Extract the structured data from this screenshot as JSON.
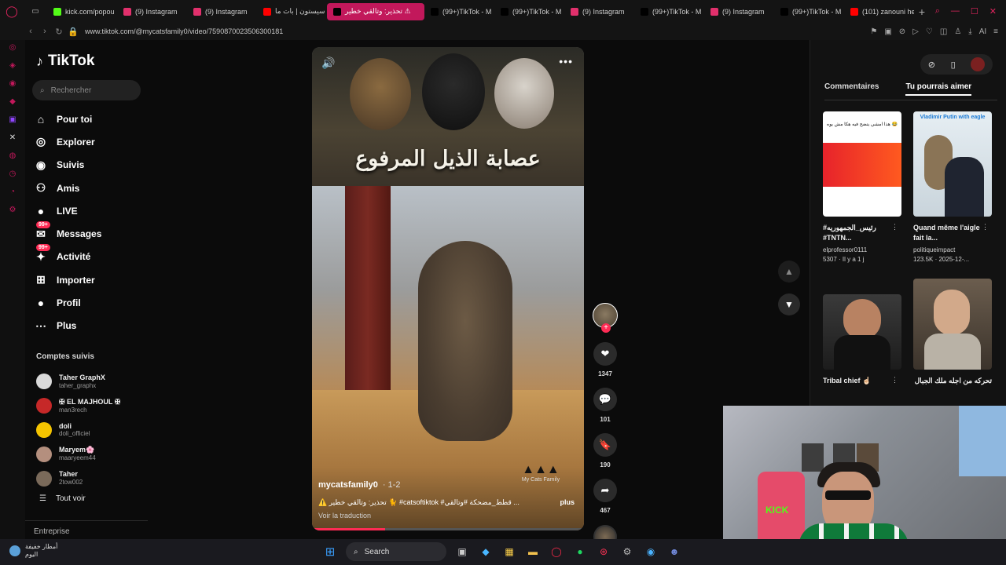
{
  "browser": {
    "tabs": [
      {
        "label": "kick.com/popou",
        "color": "#53fc18"
      },
      {
        "label": "(9) Instagram",
        "color": "#e1306c"
      },
      {
        "label": "(9) Instagram",
        "color": "#e1306c"
      },
      {
        "label": "سيستون | بات ما",
        "color": "#ff0000"
      },
      {
        "label": "تحذير: وتالقي خطير ⚠",
        "color": "#000000",
        "active": true
      },
      {
        "label": "(99+)TikTok - M",
        "color": "#000000"
      },
      {
        "label": "(99+)TikTok - M",
        "color": "#000000"
      },
      {
        "label": "(9) Instagram",
        "color": "#e1306c"
      },
      {
        "label": "(99+)TikTok - M",
        "color": "#000000"
      },
      {
        "label": "(9) Instagram",
        "color": "#e1306c"
      },
      {
        "label": "(99+)TikTok - M",
        "color": "#000000"
      },
      {
        "label": "(101) zanouni he",
        "color": "#ff0000"
      }
    ],
    "url": "www.tiktok.com/@mycatsfamily0/video/7590870023506300181",
    "ai_label": "AI"
  },
  "sidebar": {
    "logo": "TikTok",
    "search_placeholder": "Rechercher",
    "menu": [
      {
        "label": "Pour toi",
        "icon": "home-icon"
      },
      {
        "label": "Explorer",
        "icon": "compass-icon"
      },
      {
        "label": "Suivis",
        "icon": "following-icon"
      },
      {
        "label": "Amis",
        "icon": "friends-icon"
      },
      {
        "label": "LIVE",
        "icon": "live-icon"
      },
      {
        "label": "Messages",
        "icon": "messages-icon",
        "badge": "99+"
      },
      {
        "label": "Activité",
        "icon": "activity-icon",
        "badge": "99+"
      },
      {
        "label": "Importer",
        "icon": "upload-icon"
      },
      {
        "label": "Profil",
        "icon": "profile-icon"
      },
      {
        "label": "Plus",
        "icon": "more-icon"
      }
    ],
    "accounts_title": "Comptes suivis",
    "accounts": [
      {
        "name": "Taher GraphX",
        "handle": "taher_graphx"
      },
      {
        "name": "✠ EL MAJHOUL ✠",
        "handle": "man3rech"
      },
      {
        "name": "doli",
        "handle": "doli_officiel"
      },
      {
        "name": "Maryem🌸",
        "handle": "maaryeem44"
      },
      {
        "name": "Taher",
        "handle": "2tow002"
      }
    ],
    "see_all": "Tout voir",
    "footer": "Entreprise"
  },
  "video": {
    "title_overlay": "عصابة الذيل المرفوع",
    "author": "mycatsfamily0",
    "date": "· 1-2",
    "caption": "⚠️ تحذير: وتالقي خطير 🐈 #catsoftiktok #قطط_مضحكة #وتالقي ...",
    "more": "plus",
    "translate": "Voir la traduction",
    "watermark": "My Cats Family",
    "progress": 0.27
  },
  "actions": {
    "likes": "1347",
    "comments": "101",
    "saves": "190",
    "shares": "467"
  },
  "right_panel": {
    "tabs": [
      "Commentaires",
      "Tu pourrais aimer"
    ],
    "active_tab": 1,
    "recs": [
      {
        "title": "#رئيس_الجمهوريه #TNTN...",
        "author": "elprofessor0111",
        "meta": "5307 · Il y a 1 j",
        "thumb_text": "هذا امشي يتضح فيه هكا مش يوه 😂"
      },
      {
        "title": "Quand même l'aigle fait la...",
        "author": "politiqueimpact",
        "meta": "123.5K · 2025-12-...",
        "thumb_text": "Vladimir Putin with eagle"
      },
      {
        "title": "Tribal chief ☝🏻",
        "author": "",
        "meta": "",
        "thumb_text": ""
      },
      {
        "title": "تحركه من اجله ملك الجبال",
        "author": "",
        "meta": "",
        "thumb_text": ""
      }
    ]
  },
  "taskbar": {
    "weather_line1": "أمطار خفيفة",
    "weather_line2": "اليوم",
    "search": "Search"
  }
}
